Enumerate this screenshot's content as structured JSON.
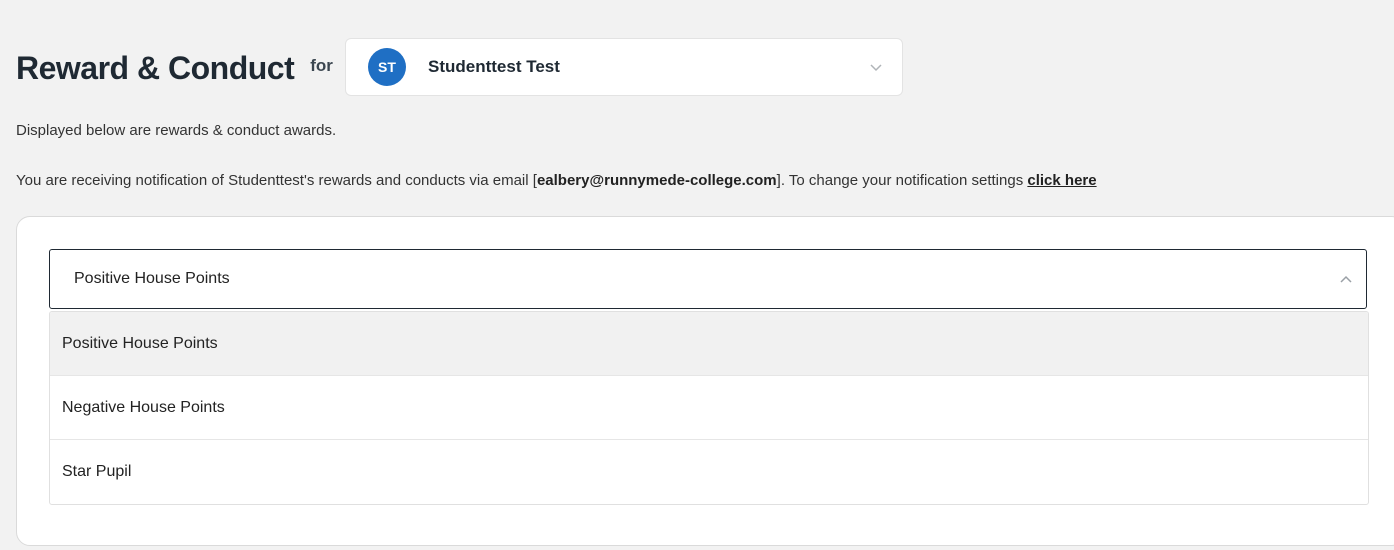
{
  "header": {
    "title": "Reward & Conduct",
    "for_label": "for"
  },
  "student_select": {
    "initials": "ST",
    "name": "Studenttest Test",
    "avatar_color": "#1f6fc4"
  },
  "description": {
    "line1": "Displayed below are rewards & conduct awards.",
    "line2_prefix": "You are receiving notification of Studenttest's rewards and conducts via email [",
    "email": "ealbery@runnymede-college.com",
    "line2_middle": "]. To change your notification settings ",
    "link": "click here"
  },
  "type_select": {
    "selected": "Positive House Points",
    "expanded": true,
    "options": [
      "Positive House Points",
      "Negative House Points",
      "Star Pupil"
    ],
    "highlighted_index": 0
  },
  "icons": {
    "student_chevron": "chevron-down-icon",
    "type_chevron": "chevron-up-icon"
  }
}
